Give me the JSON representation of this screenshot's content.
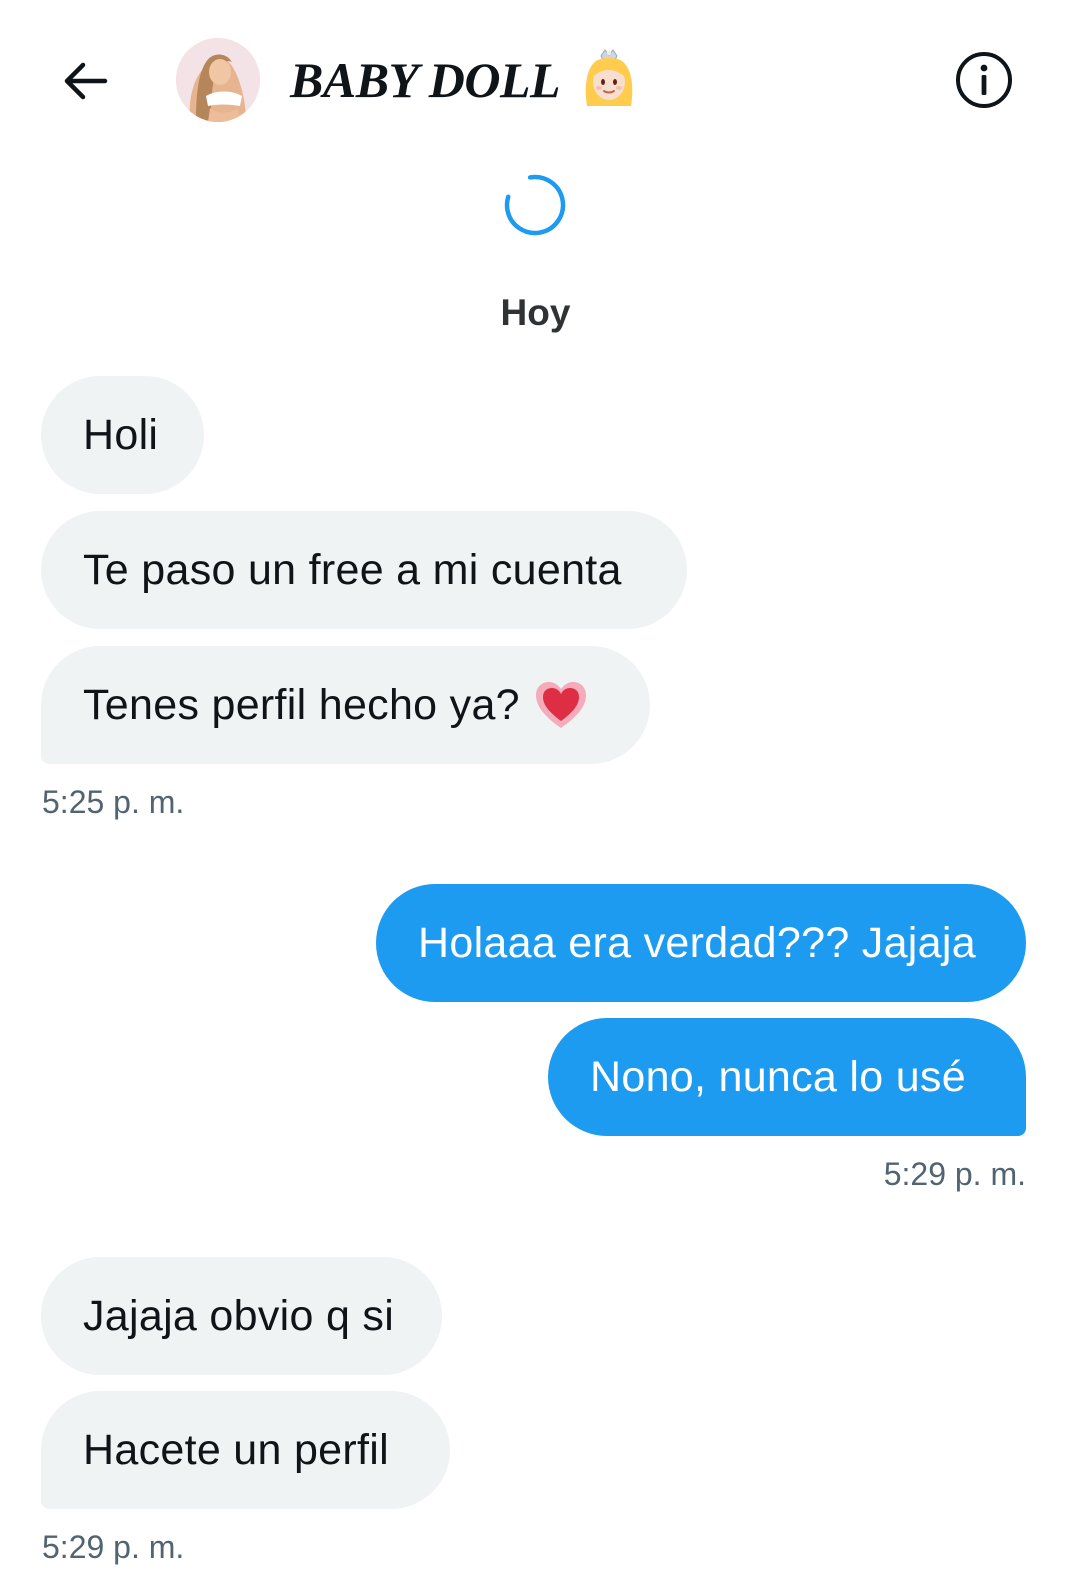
{
  "header": {
    "title": "BABY DOLL",
    "title_emoji": "princess-emoji",
    "back_icon": "arrow-left-icon",
    "info_icon": "info-icon"
  },
  "conversation": {
    "day_label": "Hoy",
    "groups": [
      {
        "sender": "them",
        "messages": [
          "Holi",
          "Te paso un free a mi cuenta",
          "Tenes perfil hecho ya?"
        ],
        "timestamp": "5:25 p. m."
      },
      {
        "sender": "me",
        "messages": [
          "Holaaa era verdad??? Jajaja",
          "Nono, nunca lo usé"
        ],
        "timestamp": "5:29 p. m."
      },
      {
        "sender": "them",
        "messages": [
          "Jajaja obvio q si",
          "Hacete un perfil"
        ],
        "timestamp": "5:29 p. m."
      }
    ]
  },
  "colors": {
    "outgoing_bubble": "#1d9bf0",
    "incoming_bubble": "#eff3f4",
    "text_primary": "#0f1419",
    "text_secondary": "#536471"
  }
}
